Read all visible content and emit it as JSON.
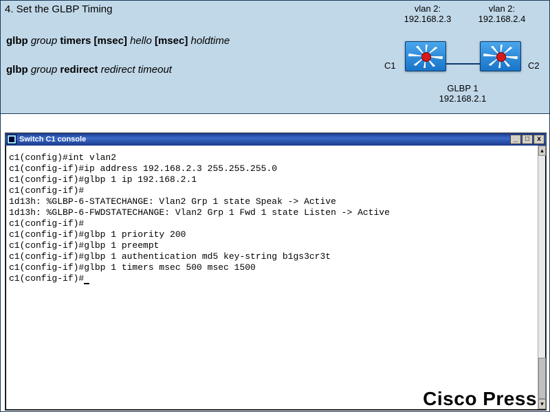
{
  "section_title": "4. Set the GLBP Timing",
  "cmd1": {
    "p1": "glbp ",
    "p2": "group",
    "p3": " timers [msec] ",
    "p4": "hello",
    "p5": " [msec] ",
    "p6": "holdtime"
  },
  "cmd2": {
    "p1": "glbp ",
    "p2": "group",
    "p3": " redirect ",
    "p4": "redirect  timeout"
  },
  "net": {
    "vlan_a_label": "vlan 2:",
    "vlan_a_ip": "192.168.2.3",
    "vlan_b_label": "vlan 2:",
    "vlan_b_ip": "192.168.2.4",
    "c1": "C1",
    "c2": "C2",
    "glbp_label": "GLBP 1",
    "glbp_ip": "192.168.2.1"
  },
  "console": {
    "title": "Switch C1 console",
    "btn_min": "_",
    "btn_max": "□",
    "btn_close": "x",
    "lines": [
      "c1(config)#int vlan2",
      "c1(config-if)#ip address 192.168.2.3 255.255.255.0",
      "c1(config-if)#glbp 1 ip 192.168.2.1",
      "c1(config-if)#",
      "1d13h: %GLBP-6-STATECHANGE: Vlan2 Grp 1 state Speak -> Active",
      "1d13h: %GLBP-6-FWDSTATECHANGE: Vlan2 Grp 1 Fwd 1 state Listen -> Active",
      "c1(config-if)#",
      "c1(config-if)#glbp 1 priority 200",
      "c1(config-if)#glbp 1 preempt",
      "c1(config-if)#glbp 1 authentication md5 key-string b1gs3cr3t",
      "c1(config-if)#glbp 1 timers msec 500 msec 1500",
      "c1(config-if)#"
    ]
  },
  "brand": "Cisco Press"
}
